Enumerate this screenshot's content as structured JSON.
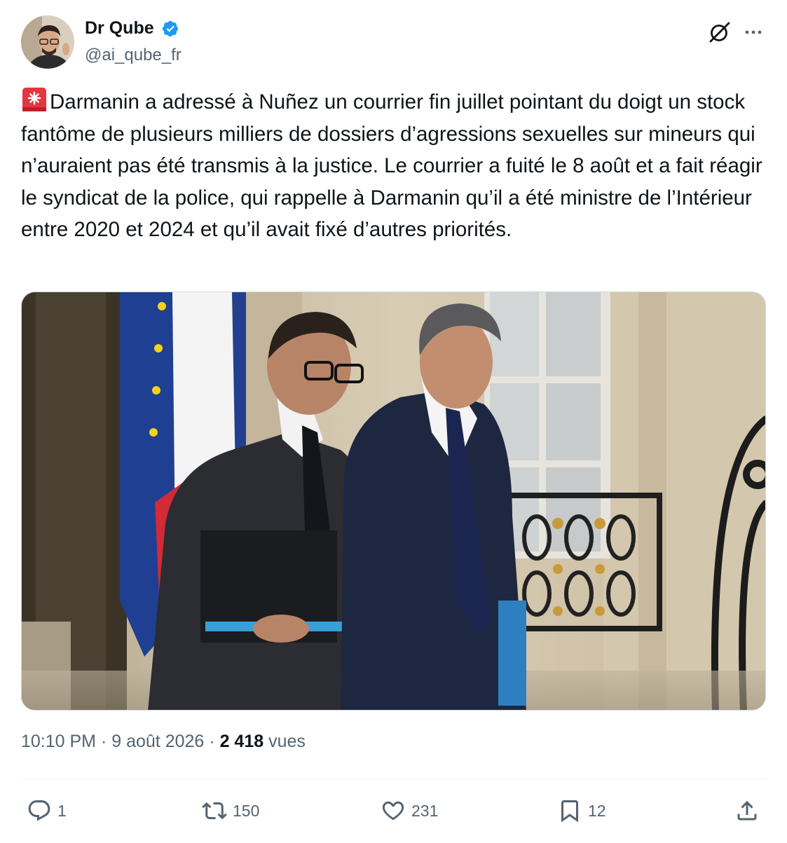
{
  "author": {
    "display_name": "Dr Qube",
    "handle": "@ai_qube_fr",
    "verified": true
  },
  "icons": {
    "verified": "verified-badge-icon",
    "grok": "grok-icon",
    "more": "more-icon",
    "siren": "siren-emoji-icon"
  },
  "tweet": {
    "text": "Darmanin a adressé à Nuñez un courrier fin juillet pointant du doigt un stock fantôme de plusieurs milliers de dossiers d’agressions sexuelles sur mineurs qui n’auraient pas été transmis à la justice. Le courrier a fuité le 8 août et a fait réagir le syndicat de la police, qui rappelle à Darmanin qu’il a été ministre de l’Intérieur entre 2020 et 2024 et qu’il avait fixé d’autres priorités."
  },
  "meta": {
    "time": "10:10 PM",
    "separator": "·",
    "date": "9 août 2026",
    "views_count": "2 418",
    "views_label": "vues"
  },
  "actions": {
    "replies": "1",
    "retweets": "150",
    "likes": "231",
    "bookmarks": "12"
  },
  "colors": {
    "text_primary": "#0f1419",
    "text_secondary": "#536471",
    "verified_blue": "#1d9bf0",
    "divider": "#eff3f4"
  }
}
